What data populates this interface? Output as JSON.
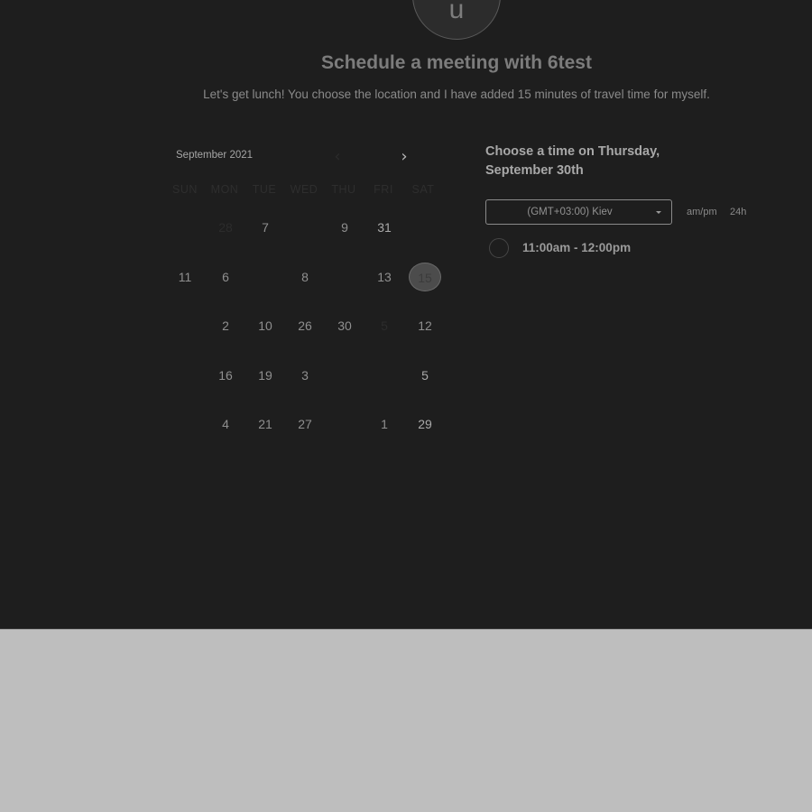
{
  "avatar": {
    "letter": "u"
  },
  "header": {
    "title": "Schedule a meeting with 6test",
    "subtitle": "Let's get lunch! You choose the location and I have added 15 minutes of travel time for myself."
  },
  "calendar": {
    "month_label": "September 2021",
    "prev_icon": "chevron-left-icon",
    "next_icon": "chevron-right-icon",
    "prev_glyph": "‹",
    "next_glyph": "›",
    "weekdays": [
      "SUN",
      "MON",
      "TUE",
      "WED",
      "THU",
      "FRI",
      "SAT"
    ],
    "weeks": [
      [
        null,
        "28",
        "7",
        null,
        "9",
        "31",
        null
      ],
      [
        "11",
        "6",
        null,
        "8",
        null,
        "13",
        "15"
      ],
      [
        null,
        "2",
        "10",
        "26",
        "30",
        "5",
        "12"
      ],
      [
        null,
        "16",
        "19",
        "3",
        null,
        null,
        "5"
      ],
      [
        null,
        "4",
        "21",
        "27",
        null,
        "1",
        "29"
      ]
    ],
    "selected": "15"
  },
  "times": {
    "heading": "Choose a time on Thursday, September 30th",
    "timezone": "(GMT+03:00) Kiev",
    "format_ampm": "am/pm",
    "format_24h": "24h",
    "slots": [
      {
        "label": "11:00am - 12:00pm"
      }
    ]
  },
  "colors": {
    "panel_bg": "#1e1e1e",
    "overlay_bg": "#bebebe"
  }
}
